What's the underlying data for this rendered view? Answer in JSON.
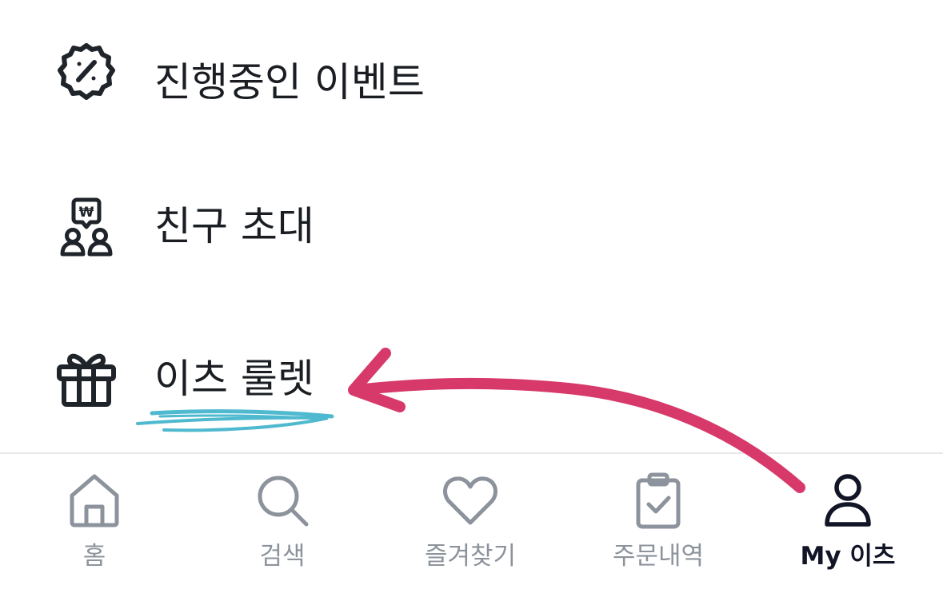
{
  "menu": {
    "items": [
      {
        "label": "진행중인 이벤트",
        "icon": "discount-badge-icon"
      },
      {
        "label": "친구 초대",
        "icon": "invite-friends-icon"
      },
      {
        "label": "이츠 룰렛",
        "icon": "gift-icon"
      }
    ]
  },
  "tabbar": {
    "tabs": [
      {
        "label": "홈",
        "icon": "home-icon",
        "active": false
      },
      {
        "label": "검색",
        "icon": "search-icon",
        "active": false
      },
      {
        "label": "즐겨찾기",
        "icon": "heart-icon",
        "active": false
      },
      {
        "label": "주문내역",
        "icon": "clipboard-check-icon",
        "active": false
      },
      {
        "label": "My 이츠",
        "icon": "user-icon",
        "active": true
      }
    ]
  },
  "annotations": {
    "underline": {
      "target": "이츠 룰렛",
      "color": "#4fb9cf"
    },
    "arrow": {
      "from": "My 이츠",
      "to": "이츠 룰렛",
      "color": "#d6396a"
    }
  },
  "colors": {
    "text_primary": "#1a1d22",
    "tab_inactive": "#8d939c",
    "tab_active": "#111526",
    "divider": "#e6e8eb"
  }
}
